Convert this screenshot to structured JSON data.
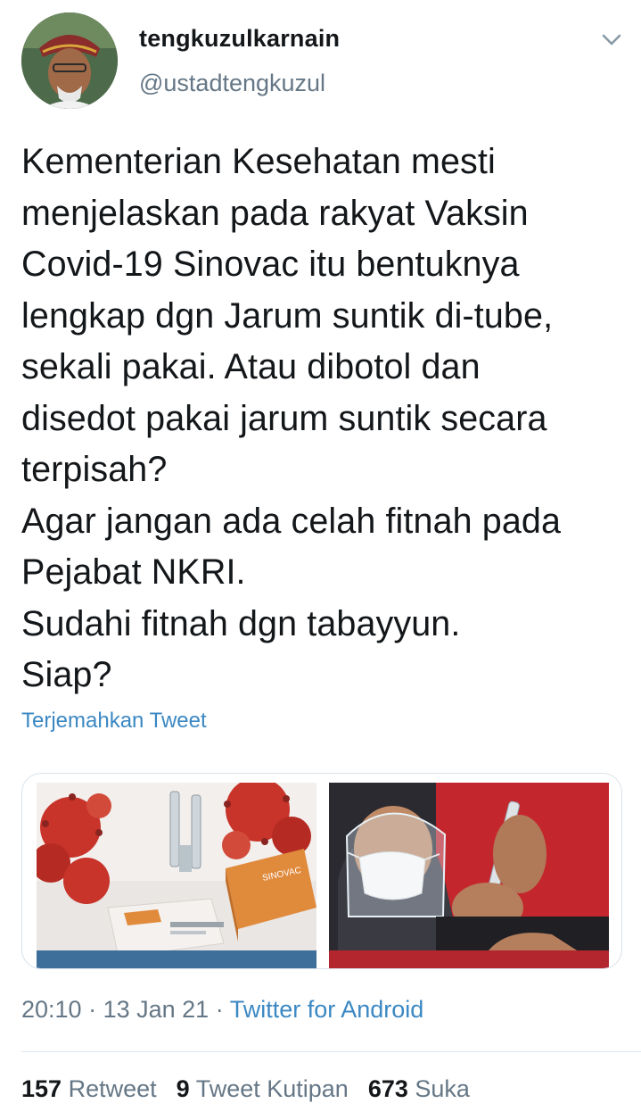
{
  "user": {
    "display_name": "tengkuzulkarnain",
    "handle": "@ustadtengkuzul"
  },
  "tweet": {
    "text": "Kementerian Kesehatan mesti\nmenjelaskan pada rakyat Vaksin\nCovid-19 Sinovac itu bentuknya\nlengkap dgn Jarum suntik di-tube,\nsekali pakai. Atau dibotol dan\ndisedot pakai jarum suntik secara\nterpisah?\nAgar jangan ada celah fitnah pada\nPejabat NKRI.\nSudahi fitnah dgn tabayyun.\nSiap?",
    "translate_label": "Terjemahkan Tweet"
  },
  "meta": {
    "time": "20:10",
    "sep1": " · ",
    "date": "13 Jan 21",
    "sep2": " · ",
    "source": "Twitter for Android"
  },
  "stats": {
    "retweets_count": "157",
    "retweets_label": "Retweet",
    "quotes_count": "9",
    "quotes_label": "Tweet Kutipan",
    "likes_count": "673",
    "likes_label": "Suka"
  },
  "media": {
    "left_box_text": "SINOVAC",
    "colors": {
      "virus_red": "#c8332a",
      "box_orange": "#e08a3c",
      "backdrop_red": "#c4262e",
      "accent_blue": "#3b88c3"
    }
  }
}
